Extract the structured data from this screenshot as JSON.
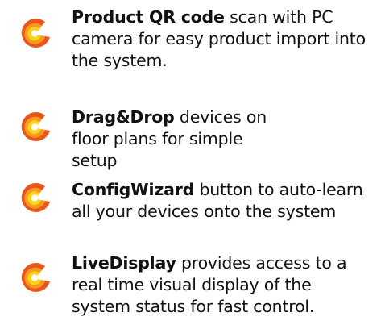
{
  "features": [
    {
      "title": "Product QR code",
      "description": " scan with PC camera for easy product import into the system.",
      "icon": "swirl-logo-icon"
    },
    {
      "title": "Drag&Drop",
      "description": " devices on floor plans for simple setup",
      "icon": "swirl-logo-icon"
    },
    {
      "title": "ConfigWizard",
      "description": " button to auto-learn all your devices onto the system",
      "icon": "swirl-logo-icon"
    },
    {
      "title": "LiveDisplay",
      "description": " provides access to a real time visual display of the system status for fast control.",
      "icon": "swirl-logo-icon"
    }
  ],
  "colors": {
    "icon_outer": "#e8561c",
    "icon_mid": "#f39a1f",
    "icon_inner": "#fcd21c",
    "text": "#111111"
  }
}
